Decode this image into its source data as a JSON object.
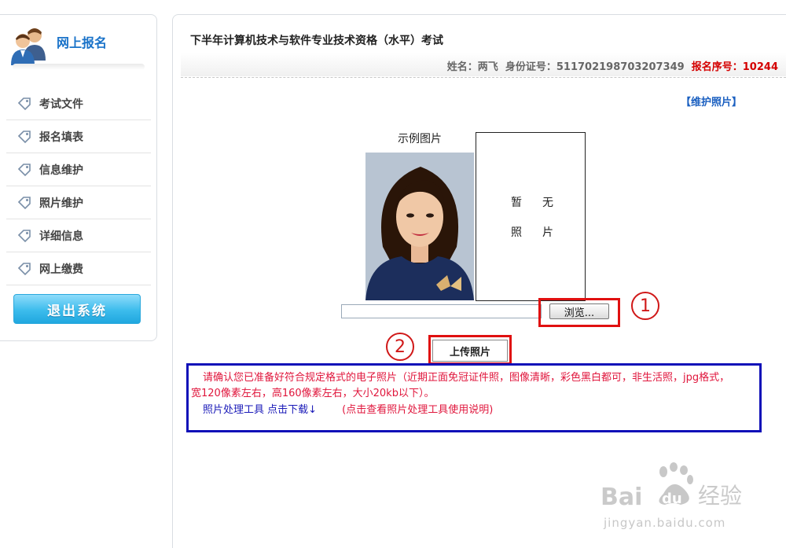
{
  "sidebar": {
    "title": "网上报名",
    "items": [
      {
        "label": "考试文件"
      },
      {
        "label": "报名填表"
      },
      {
        "label": "信息维护"
      },
      {
        "label": "照片维护"
      },
      {
        "label": "详细信息"
      },
      {
        "label": "网上缴费"
      }
    ],
    "logout_label": "退出系统"
  },
  "main": {
    "exam_title": "下半年计算机技术与软件专业技术资格（水平）考试",
    "candidate": {
      "name_label": "姓名：",
      "name": "两飞",
      "id_label": "身份证号：",
      "id_number": "511702198703207349",
      "reg_label": "报名序号：",
      "reg_number": "10244"
    },
    "maintain_link": "【维护照片】",
    "sample_label": "示例图片",
    "no_photo": [
      "暂",
      "无",
      "照",
      "片"
    ],
    "browse_label": "浏览...",
    "upload_label": "上传照片",
    "annotations": [
      "1",
      "2"
    ],
    "notice": {
      "line1": "请确认您已准备好符合规定格式的电子照片（近期正面免冠证件照，图像清晰，彩色黑白都可，非生活照，jpg格式，",
      "line2": "宽120像素左右，高160像素左右，大小20kb以下）。",
      "tool_link": "照片处理工具 点击下载↓",
      "tool_help": "(点击查看照片处理工具使用说明)"
    }
  },
  "watermark": {
    "brand": "Baidu经验",
    "url": "jingyan.baidu.com"
  },
  "colors": {
    "accent_blue": "#1a73c9",
    "highlight_red": "#e01010",
    "notice_border": "#1010b8",
    "notice_text": "#e0163c"
  }
}
